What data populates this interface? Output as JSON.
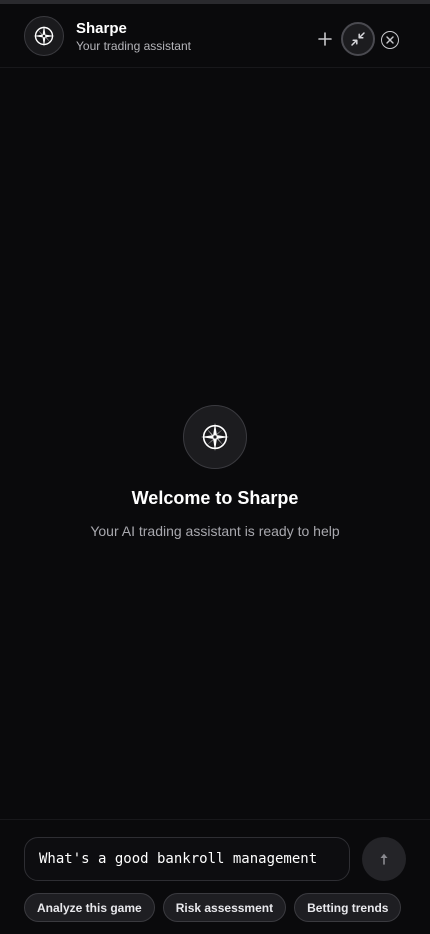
{
  "header": {
    "title": "Sharpe",
    "subtitle": "Your trading assistant",
    "avatar_icon": "compass-icon",
    "actions": {
      "new_chat_icon": "plus-icon",
      "collapse_icon": "collapse-arrows-icon",
      "close_icon": "close-circle-icon"
    }
  },
  "welcome": {
    "logo_icon": "compass-icon",
    "title": "Welcome to Sharpe",
    "subtitle": "Your AI trading assistant is ready to help"
  },
  "composer": {
    "input_value": "What's a good bankroll management",
    "send_icon": "arrow-up-icon",
    "suggestions": [
      {
        "label": "Analyze this game"
      },
      {
        "label": "Risk assessment"
      },
      {
        "label": "Betting trends"
      }
    ]
  },
  "colors": {
    "background": "#0a0a0c",
    "surface": "#1c1c1f",
    "border": "#3a3a3f",
    "text_primary": "#ffffff",
    "text_secondary": "#a8a8ae"
  }
}
